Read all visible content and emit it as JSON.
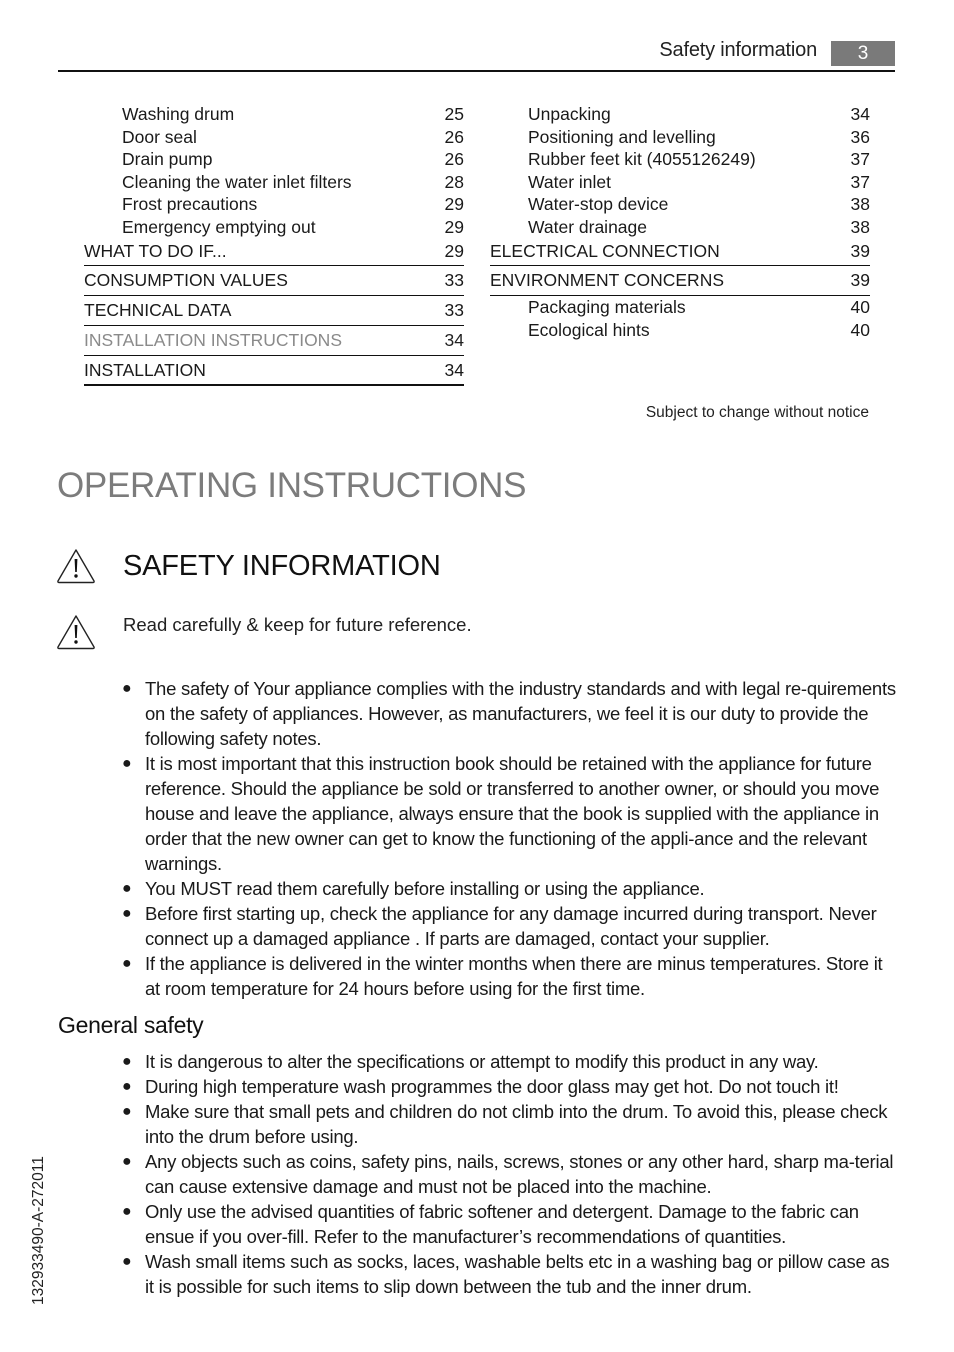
{
  "header": {
    "section_title": "Safety information",
    "page_number": "3"
  },
  "toc": {
    "left": [
      {
        "title": "Washing drum",
        "page": "25",
        "level": "sub"
      },
      {
        "title": "Door seal",
        "page": "26",
        "level": "sub"
      },
      {
        "title": "Drain pump",
        "page": "26",
        "level": "sub"
      },
      {
        "title": "Cleaning the water inlet filters",
        "page": "28",
        "level": "sub"
      },
      {
        "title": "Frost precautions",
        "page": "29",
        "level": "sub"
      },
      {
        "title": "Emergency emptying out",
        "page": "29",
        "level": "sub"
      },
      {
        "title": "WHAT TO DO IF...",
        "page": "29",
        "level": "main"
      },
      {
        "title": "CONSUMPTION VALUES",
        "page": "33",
        "level": "main"
      },
      {
        "title": "TECHNICAL DATA",
        "page": "33",
        "level": "main"
      },
      {
        "title": "INSTALLATION INSTRUCTIONS",
        "page": "34",
        "level": "main-gray"
      },
      {
        "title": "INSTALLATION",
        "page": "34",
        "level": "main"
      }
    ],
    "right": [
      {
        "title": "Unpacking",
        "page": "34",
        "level": "sub"
      },
      {
        "title": "Positioning and levelling",
        "page": "36",
        "level": "sub"
      },
      {
        "title": "Rubber feet kit (4055126249)",
        "page": "37",
        "level": "sub"
      },
      {
        "title": "Water inlet",
        "page": "37",
        "level": "sub"
      },
      {
        "title": "Water-stop device",
        "page": "38",
        "level": "sub"
      },
      {
        "title": "Water drainage",
        "page": "38",
        "level": "sub"
      },
      {
        "title": "ELECTRICAL CONNECTION",
        "page": "39",
        "level": "main"
      },
      {
        "title": "ENVIRONMENT CONCERNS",
        "page": "39",
        "level": "main"
      },
      {
        "title": "Packaging materials",
        "page": "40",
        "level": "sub"
      },
      {
        "title": "Ecological hints",
        "page": "40",
        "level": "sub"
      }
    ],
    "notice": "Subject to change without notice"
  },
  "content": {
    "chapter_title": "OPERATING INSTRUCTIONS",
    "section_title": "SAFETY INFORMATION",
    "warning_icon": "warning-triangle-icon",
    "read_note": "Read carefully & keep for future reference.",
    "safety_bullets": [
      "The safety of Your appliance complies with the industry standards and with legal re-quirements on the safety of appliances. However, as manufacturers, we feel it is our duty to provide the following safety notes.",
      "It is most important that this instruction book should be retained with the appliance for future reference. Should the appliance be sold or transferred to another owner, or should you move house and leave the appliance, always ensure that the book is supplied with the appliance in order that the new owner can get to know the functioning of the appli-ance and the relevant warnings.",
      "You MUST read them carefully before installing or using the appliance.",
      "Before first starting up, check the appliance for any damage incurred during transport. Never connect up a damaged appliance . If parts are damaged, contact your supplier.",
      "If the appliance is delivered in the winter months when there are minus temperatures. Store it at room temperature for 24 hours before using for the first time."
    ],
    "general_safety_title": "General safety",
    "general_bullets": [
      "It is dangerous to alter the specifications or attempt to modify this product in any way.",
      "During high temperature wash programmes the door glass may get hot. Do not touch it!",
      "Make sure that small pets and children do not climb into the drum. To avoid this, please check into the drum before using.",
      "Any objects such as coins, safety pins, nails, screws, stones or any other hard, sharp ma-terial can cause extensive damage and must not be placed into the machine.",
      "Only use the advised quantities of fabric softener and detergent. Damage to the fabric can ensue if you over-fill. Refer to the manufacturer’s recommendations of quantities.",
      "Wash small items such as socks, laces, washable belts etc in a washing bag or pillow case as it is possible for such items to slip down between the tub and the inner drum."
    ]
  },
  "footer": {
    "document_code": "132933490-A-272011"
  },
  "colors": {
    "page_badge": "#7a7a7a",
    "chapter_title": "#7c7c7c",
    "gray_toc_entry": "#8a8a8a"
  }
}
